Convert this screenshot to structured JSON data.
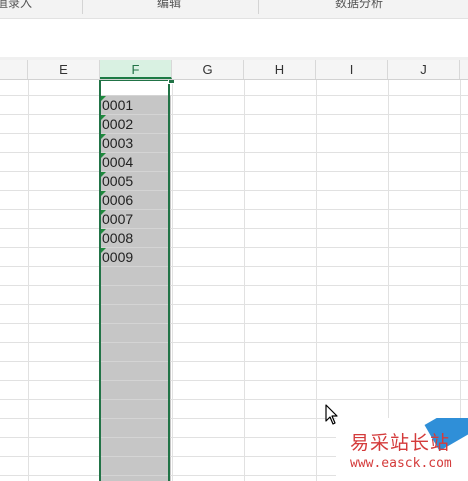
{
  "ribbon": {
    "groups": [
      {
        "label": "值录入"
      },
      {
        "label": "编辑"
      },
      {
        "label": "数据分析"
      }
    ]
  },
  "columns": [
    {
      "label": "E",
      "selected": false
    },
    {
      "label": "F",
      "selected": true
    },
    {
      "label": "G",
      "selected": false
    },
    {
      "label": "H",
      "selected": false
    },
    {
      "label": "I",
      "selected": false
    },
    {
      "label": "J",
      "selected": false
    }
  ],
  "selection": {
    "column": "F",
    "accent_color": "#217346",
    "fill_color": "#c6c6c6"
  },
  "cells": {
    "column_F": [
      "0001",
      "0002",
      "0003",
      "0004",
      "0005",
      "0006",
      "0007",
      "0008",
      "0009"
    ]
  },
  "watermark": {
    "title": "易采站长站",
    "url": "www.easck.com"
  },
  "icons": {
    "error_indicator": "green-corner-triangle-icon",
    "mouse_cursor": "arrow-cursor-icon"
  }
}
